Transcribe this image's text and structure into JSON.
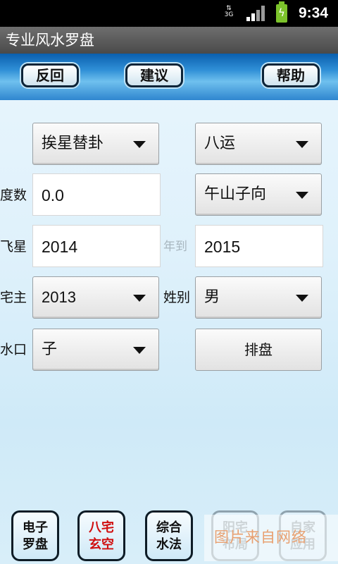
{
  "status_bar": {
    "network": "3G",
    "time": "9:34",
    "icons": [
      "data-arrows-icon",
      "signal-icon",
      "battery-charging-icon"
    ]
  },
  "app": {
    "title": "专业风水罗盘"
  },
  "toolbar": {
    "back": "反回",
    "suggest": "建议",
    "help": "帮助"
  },
  "form": {
    "method_select": "挨星替卦",
    "period_select": "八运",
    "degree_label": "度数",
    "degree_value": "0.0",
    "facing_select": "午山子向",
    "flying_star_label": "飞星",
    "year_from": "2014",
    "year_to_label": "年到",
    "year_to": "2015",
    "owner_label": "宅主",
    "owner_year": "2013",
    "gender_label": "姓别",
    "gender_value": "男",
    "water_label": "水口",
    "water_value": "子",
    "arrange_button": "排盘"
  },
  "bottom_nav": [
    {
      "line1": "电子",
      "line2": "罗盘"
    },
    {
      "line1": "八宅",
      "line2": "玄空"
    },
    {
      "line1": "综合",
      "line2": "水法"
    },
    {
      "line1": "阳宅",
      "line2": "布局"
    },
    {
      "line1": "自家",
      "line2": "应用"
    }
  ],
  "watermark": "图片来自网络",
  "colors": {
    "accent_red": "#d01010",
    "toolbar_blue": "#2f8fd6",
    "battery_green": "#7cc32b"
  }
}
